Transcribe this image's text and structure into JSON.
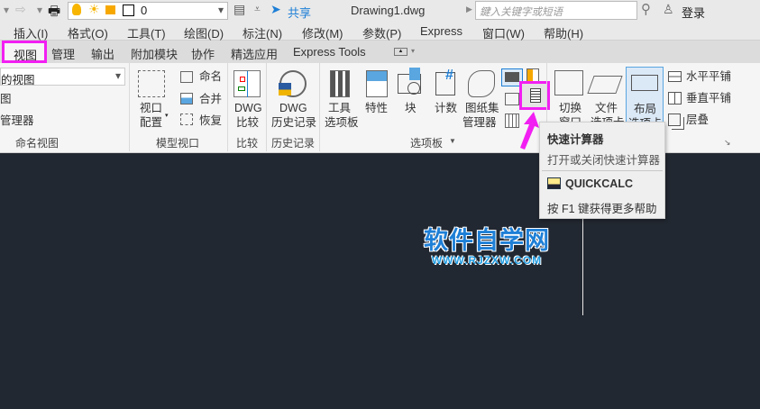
{
  "qat": {
    "layer_value": "0",
    "share_label": "共享",
    "file_title": "Drawing1.dwg",
    "search_placeholder": "鍵入关键字或短语",
    "login_label": "登录"
  },
  "menu": [
    "插入(I)",
    "格式(O)",
    "工具(T)",
    "绘图(D)",
    "标注(N)",
    "修改(M)",
    "参数(P)",
    "Express",
    "窗口(W)",
    "帮助(H)"
  ],
  "tabs": [
    "视图",
    "管理",
    "输出",
    "附加模块",
    "协作",
    "精选应用",
    "Express Tools"
  ],
  "active_tab": "视图",
  "ribbon": {
    "named_views": {
      "combo_value": "的视图",
      "item1": "图",
      "item2": "管理器",
      "label": "命名视图"
    },
    "model_viewports": {
      "config_line1": "视口",
      "config_line2": "配置",
      "name": "命名",
      "merge": "合并",
      "restore": "恢复",
      "label": "模型视口"
    },
    "compare": {
      "line1": "DWG",
      "line2": "比较",
      "label": "比较"
    },
    "history": {
      "line1": "DWG",
      "line2": "历史记录",
      "label": "历史记录"
    },
    "palettes": {
      "tool_line1": "工具",
      "tool_line2": "选项板",
      "properties": "特性",
      "block": "块",
      "count": "计数",
      "sheetset_line1": "图纸集",
      "sheetset_line2": "管理器",
      "label": "选项板"
    },
    "interface": {
      "switch_line1": "切换",
      "switch_line2": "窗口",
      "file_line1": "文件",
      "file_line2": "选项卡",
      "layout_line1": "布局",
      "layout_line2": "选项卡",
      "tile_h": "水平平铺",
      "tile_v": "垂直平铺",
      "cascade": "层叠"
    }
  },
  "tooltip": {
    "title": "快速计算器",
    "description": "打开或关闭快速计算器",
    "command": "QUICKCALC",
    "help": "按 F1 键获得更多帮助"
  },
  "watermark": {
    "cn": "软件自学网",
    "url": "WWW.RJZXW.COM"
  },
  "colors": {
    "highlight": "#f21ff2",
    "canvas": "#222831",
    "accent": "#1e7fd6"
  }
}
